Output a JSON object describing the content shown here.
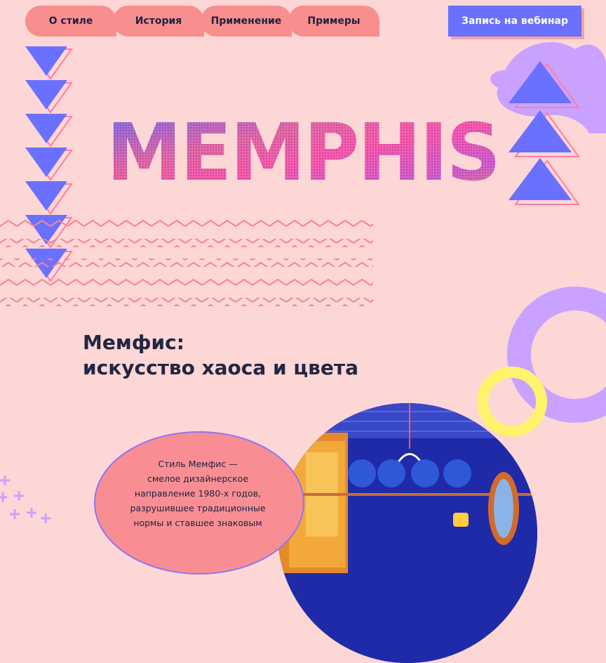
{
  "nav": {
    "items": [
      {
        "label": "О стиле"
      },
      {
        "label": "История"
      },
      {
        "label": "Применение"
      },
      {
        "label": "Примеры"
      }
    ],
    "cta_label": "Запись на вебинар"
  },
  "hero": {
    "logo_text": "MEMPHIS"
  },
  "headline": {
    "line1": "Мемфис:",
    "line2": "искусство хаоса и цвета"
  },
  "intro": {
    "lines": [
      "Стиль Мемфис —",
      "смелое дизайнерское",
      "направление 1980-х годов,",
      "разрушившее традиционные",
      "нормы и ставшее знаковым"
    ]
  },
  "colors": {
    "background": "#fdd6d6",
    "coral": "#f98e8e",
    "accent_blue": "#6a70ff",
    "lilac": "#c9a2ff",
    "yellow": "#fff36e",
    "text": "#1f2340"
  }
}
